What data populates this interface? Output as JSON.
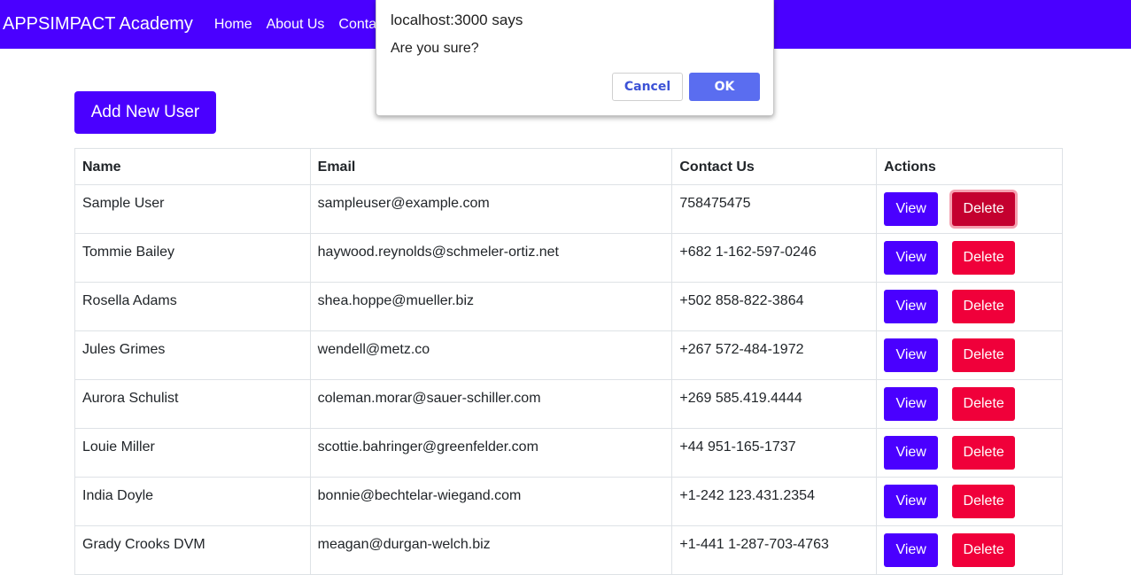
{
  "navbar": {
    "brand": "APPSIMPACT Academy",
    "links": [
      "Home",
      "About Us",
      "Contact Us"
    ]
  },
  "add_user_label": "Add New User",
  "table": {
    "headers": [
      "Name",
      "Email",
      "Contact Us",
      "Actions"
    ],
    "view_label": "View",
    "delete_label": "Delete",
    "rows": [
      [
        "Sample User",
        "sampleuser@example.com",
        "758475475"
      ],
      [
        "Tommie Bailey",
        "haywood.reynolds@schmeler-ortiz.net",
        "+682 1-162-597-0246"
      ],
      [
        "Rosella Adams",
        "shea.hoppe@mueller.biz",
        "+502 858-822-3864"
      ],
      [
        "Jules Grimes",
        "wendell@metz.co",
        "+267 572-484-1972"
      ],
      [
        "Aurora Schulist",
        "coleman.morar@sauer-schiller.com",
        "+269 585.419.4444"
      ],
      [
        "Louie Miller",
        "scottie.bahringer@greenfelder.com",
        "+44 951-165-1737"
      ],
      [
        "India Doyle",
        "bonnie@bechtelar-wiegand.com",
        "+1-242 123.431.2354"
      ],
      [
        "Grady Crooks DVM",
        "meagan@durgan-welch.biz",
        "+1-441 1-287-703-4763"
      ]
    ]
  },
  "dialog": {
    "title": "localhost:3000 says",
    "message": "Are you sure?",
    "cancel_label": "Cancel",
    "ok_label": "OK"
  },
  "colors": {
    "primary": "#4a00ff",
    "danger": "#f0003a",
    "dialog_ok": "#5a6df0"
  }
}
